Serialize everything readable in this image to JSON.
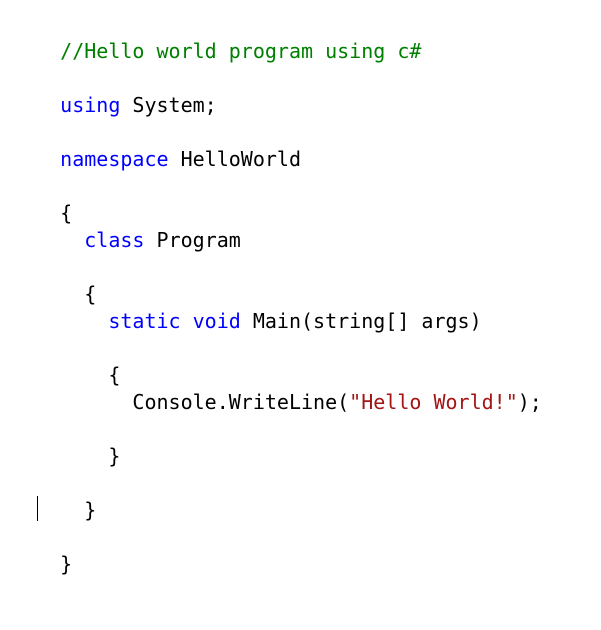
{
  "editor": {
    "lines": [
      {
        "comment": "//Hello world program using c#"
      },
      {
        "keyword": "using",
        "rest": " System;"
      },
      {
        "keyword": "namespace",
        "rest": " HelloWorld"
      },
      {
        "text": "{"
      },
      {
        "indent": "  ",
        "keyword": "class",
        "rest": " Program"
      },
      {
        "text": "  {"
      },
      {
        "indent": "    ",
        "keyword1": "static",
        "space": " ",
        "keyword2": "void",
        "rest": " Main(string[] args)"
      },
      {
        "text": "    {"
      },
      {
        "indent": "      ",
        "before": "Console.WriteLine(",
        "string": "\"Hello World!\"",
        "after": ");"
      },
      {
        "text": "    }"
      },
      {
        "text": "  }"
      },
      {
        "text": "}"
      }
    ]
  },
  "colors": {
    "comment": "#008000",
    "keyword": "#0000ff",
    "string": "#a31515",
    "text": "#000000",
    "background": "#ffffff"
  }
}
